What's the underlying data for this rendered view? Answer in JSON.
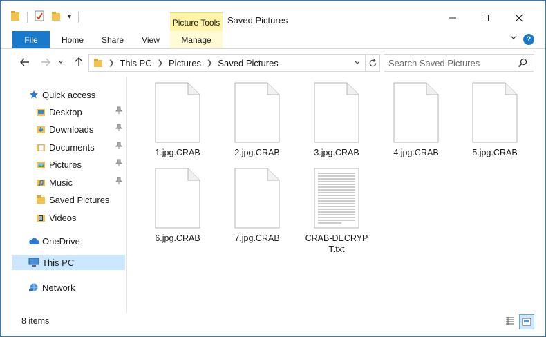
{
  "window": {
    "title": "Saved Pictures",
    "contextual_tab_group": "Picture Tools"
  },
  "ribbon": {
    "tabs": [
      {
        "label": "File"
      },
      {
        "label": "Home"
      },
      {
        "label": "Share"
      },
      {
        "label": "View"
      },
      {
        "label": "Manage"
      }
    ],
    "help_label": "?"
  },
  "address_bar": {
    "breadcrumbs": [
      "This PC",
      "Pictures",
      "Saved Pictures"
    ]
  },
  "search": {
    "placeholder": "Search Saved Pictures"
  },
  "sidebar": {
    "quick_access": {
      "label": "Quick access",
      "items": [
        {
          "label": "Desktop",
          "icon": "desktop-folder-icon",
          "pinned": true
        },
        {
          "label": "Downloads",
          "icon": "downloads-folder-icon",
          "pinned": true
        },
        {
          "label": "Documents",
          "icon": "documents-folder-icon",
          "pinned": true
        },
        {
          "label": "Pictures",
          "icon": "pictures-folder-icon",
          "pinned": true
        },
        {
          "label": "Music",
          "icon": "music-folder-icon",
          "pinned": true
        },
        {
          "label": "Saved Pictures",
          "icon": "folder-icon",
          "pinned": false
        },
        {
          "label": "Videos",
          "icon": "videos-folder-icon",
          "pinned": false
        }
      ]
    },
    "onedrive": {
      "label": "OneDrive"
    },
    "this_pc": {
      "label": "This PC",
      "selected": true
    },
    "network": {
      "label": "Network"
    }
  },
  "files": [
    {
      "name": "1.jpg.CRAB",
      "type": "blank"
    },
    {
      "name": "2.jpg.CRAB",
      "type": "blank"
    },
    {
      "name": "3.jpg.CRAB",
      "type": "blank"
    },
    {
      "name": "4.jpg.CRAB",
      "type": "blank"
    },
    {
      "name": "5.jpg.CRAB",
      "type": "blank"
    },
    {
      "name": "6.jpg.CRAB",
      "type": "blank"
    },
    {
      "name": "7.jpg.CRAB",
      "type": "blank"
    },
    {
      "name": "CRAB-DECRYPT.txt",
      "type": "text"
    }
  ],
  "status_bar": {
    "item_count": "8 items"
  },
  "colors": {
    "accent": "#1979ca",
    "contextual_tab": "#fff4a7",
    "selection": "#cce8ff",
    "folder": "#f2c14e"
  }
}
